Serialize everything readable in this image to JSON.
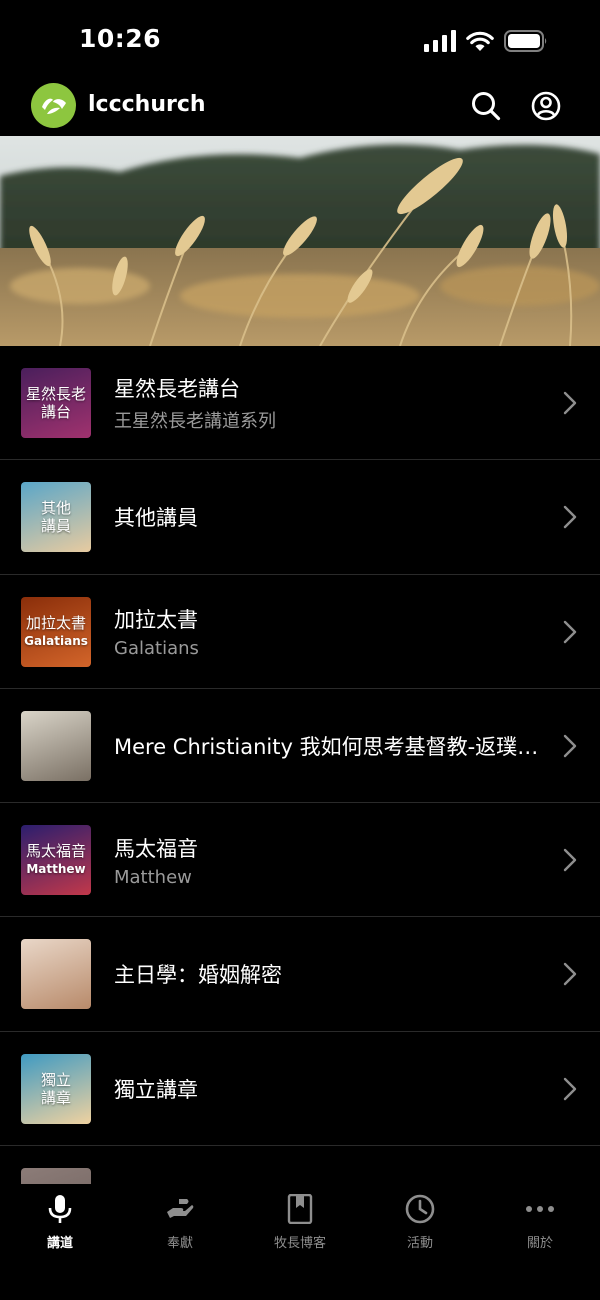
{
  "status": {
    "time": "10:26"
  },
  "header": {
    "app_name": "lccchurch",
    "logo_icon": "leaf-icon",
    "search_icon": "search-icon",
    "account_icon": "account-icon"
  },
  "series": [
    {
      "title": "星然長老講台",
      "subtitle": "王星然長老講道系列",
      "thumb_text": [
        "星然長老",
        "講台"
      ],
      "thumb_colors": [
        "#4a1f5c",
        "#a0326e"
      ]
    },
    {
      "title": "其他講員",
      "subtitle": "",
      "thumb_text": [
        "其他",
        "講員"
      ],
      "thumb_colors": [
        "#5aa6c8",
        "#e8cba0"
      ]
    },
    {
      "title": "加拉太書",
      "subtitle": "Galatians",
      "thumb_text": [
        "加拉太書",
        "Galatians"
      ],
      "thumb_colors": [
        "#8a2e0a",
        "#d3652a"
      ]
    },
    {
      "title": "Mere Christianity 我如何思考基督教-返璞歸真",
      "subtitle": "",
      "thumb_text": [],
      "thumb_colors": [
        "#d9d4c8",
        "#7a7064"
      ]
    },
    {
      "title": "馬太福音",
      "subtitle": "Matthew",
      "thumb_text": [
        "馬太福音",
        "Matthew"
      ],
      "thumb_colors": [
        "#2b1e6e",
        "#c2384a"
      ]
    },
    {
      "title": "主日學：婚姻解密",
      "subtitle": "",
      "thumb_text": [],
      "thumb_colors": [
        "#e9d7c8",
        "#b88a6a"
      ]
    },
    {
      "title": "獨立講章",
      "subtitle": "",
      "thumb_text": [
        "獨立",
        "講章"
      ],
      "thumb_colors": [
        "#3f9ac2",
        "#f0d2a0"
      ]
    },
    {
      "title": "",
      "subtitle": "",
      "thumb_text": [],
      "thumb_colors": [
        "#8c7c78",
        "#6e605c"
      ]
    }
  ],
  "tabs": [
    {
      "label": "講道",
      "icon": "microphone-icon",
      "active": true
    },
    {
      "label": "奉獻",
      "icon": "giving-hand-icon",
      "active": false
    },
    {
      "label": "牧長博客",
      "icon": "bookmark-book-icon",
      "active": false
    },
    {
      "label": "活動",
      "icon": "clock-icon",
      "active": false
    },
    {
      "label": "關於",
      "icon": "more-dots-icon",
      "active": false
    }
  ]
}
